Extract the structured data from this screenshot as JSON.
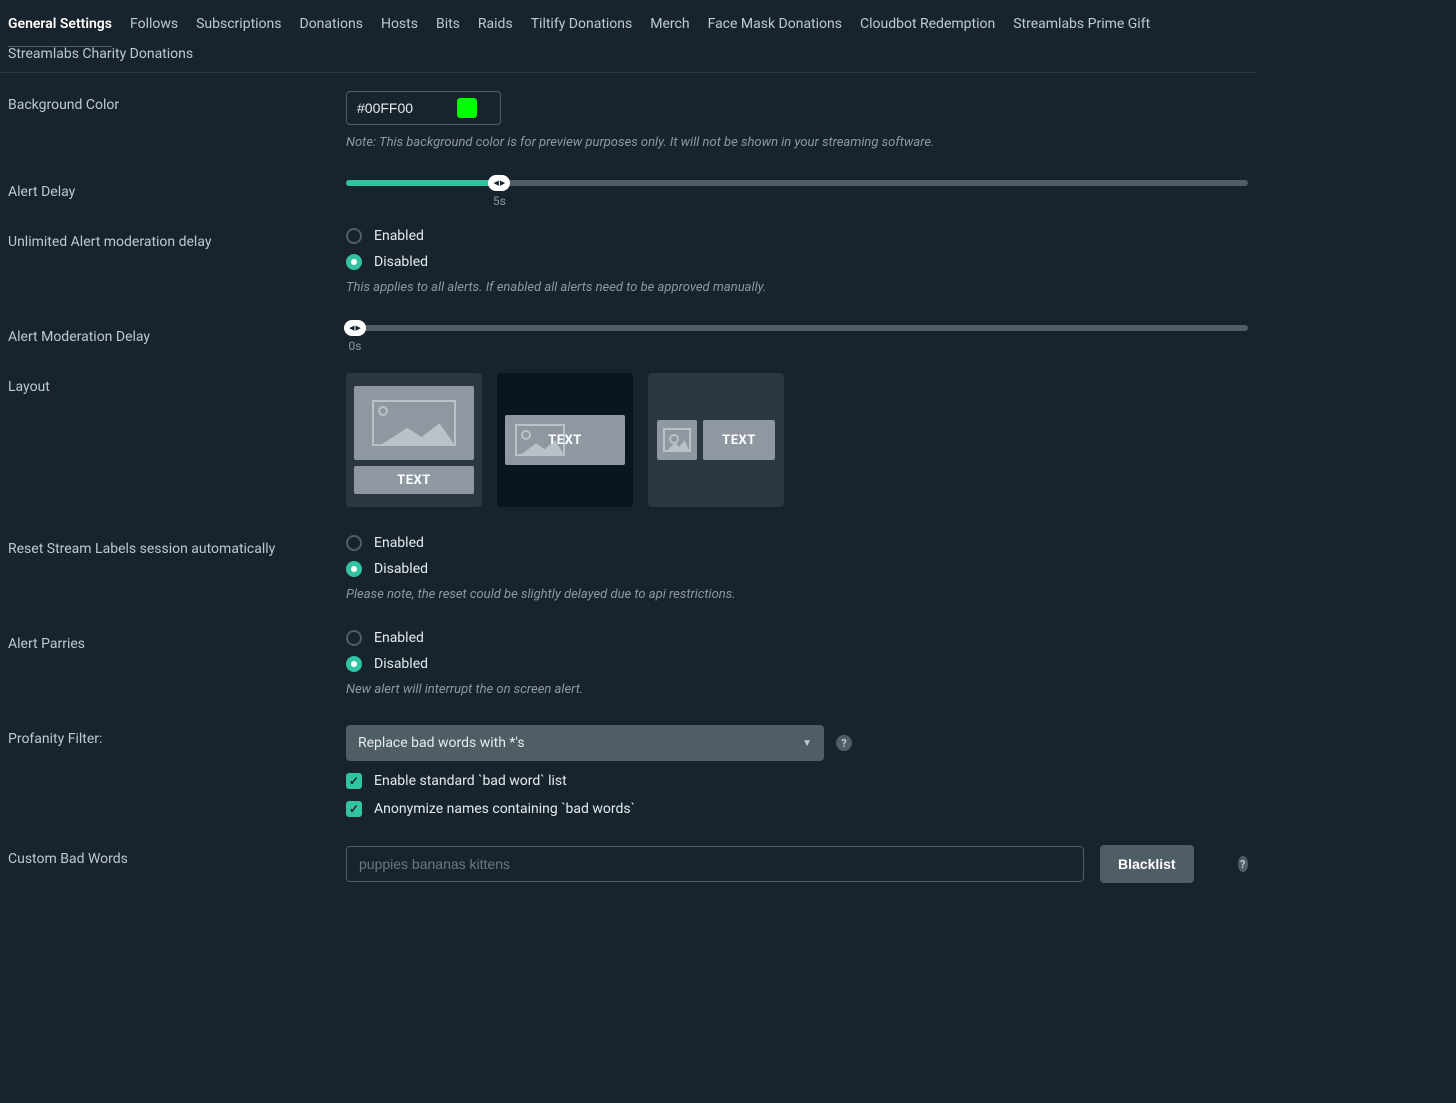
{
  "tabs": [
    "General Settings",
    "Follows",
    "Subscriptions",
    "Donations",
    "Hosts",
    "Bits",
    "Raids",
    "Tiltify Donations",
    "Merch",
    "Face Mask Donations",
    "Cloudbot Redemption",
    "Streamlabs Prime Gift",
    "Streamlabs Charity Donations"
  ],
  "active_tab": "General Settings",
  "background_color": {
    "label": "Background Color",
    "value": "#00FF00",
    "swatch": "#00FF00",
    "note": "Note: This background color is for preview purposes only. It will not be shown in your streaming software."
  },
  "alert_delay": {
    "label": "Alert Delay",
    "value_seconds": 5,
    "value_display": "5s",
    "percent": 17
  },
  "unlimited_mod_delay": {
    "label": "Unlimited Alert moderation delay",
    "options": {
      "enabled": "Enabled",
      "disabled": "Disabled"
    },
    "selected": "disabled",
    "note": "This applies to all alerts. If enabled all alerts need to be approved manually."
  },
  "alert_mod_delay": {
    "label": "Alert Moderation Delay",
    "value_seconds": 0,
    "value_display": "0s",
    "percent": 0
  },
  "layout": {
    "label": "Layout",
    "selected_index": 1,
    "text_label": "TEXT"
  },
  "reset_labels": {
    "label": "Reset Stream Labels session automatically",
    "options": {
      "enabled": "Enabled",
      "disabled": "Disabled"
    },
    "selected": "disabled",
    "note": "Please note, the reset could be slightly delayed due to api restrictions."
  },
  "alert_parries": {
    "label": "Alert Parries",
    "options": {
      "enabled": "Enabled",
      "disabled": "Disabled"
    },
    "selected": "disabled",
    "note": "New alert will interrupt the on screen alert."
  },
  "profanity": {
    "label": "Profanity Filter:",
    "selected": "Replace bad words with *'s",
    "checkbox1": "Enable standard `bad word` list",
    "checkbox2": "Anonymize names containing `bad words`",
    "checkbox1_checked": true,
    "checkbox2_checked": true
  },
  "custom_bad_words": {
    "label": "Custom Bad Words",
    "placeholder": "puppies bananas kittens",
    "value": "",
    "button": "Blacklist"
  }
}
